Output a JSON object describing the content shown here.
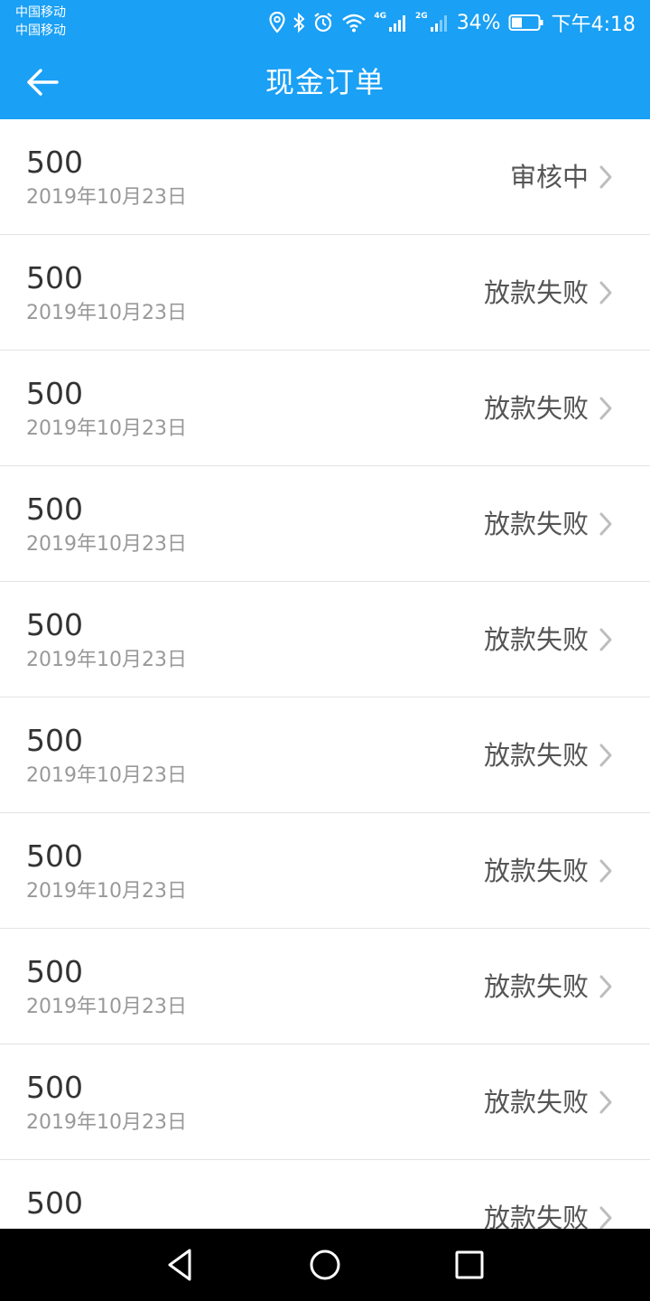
{
  "status_bar": {
    "carrier_1": "中国移动",
    "carrier_2": "中国移动",
    "network_1": "4G",
    "network_2": "2G",
    "battery": "34%",
    "time": "下午4:18"
  },
  "app_bar": {
    "title": "现金订单",
    "back_icon": "arrow-left-icon",
    "color": "#1aa0f5"
  },
  "orders": [
    {
      "amount": "500",
      "date": "2019年10月23日",
      "status": "审核中"
    },
    {
      "amount": "500",
      "date": "2019年10月23日",
      "status": "放款失败"
    },
    {
      "amount": "500",
      "date": "2019年10月23日",
      "status": "放款失败"
    },
    {
      "amount": "500",
      "date": "2019年10月23日",
      "status": "放款失败"
    },
    {
      "amount": "500",
      "date": "2019年10月23日",
      "status": "放款失败"
    },
    {
      "amount": "500",
      "date": "2019年10月23日",
      "status": "放款失败"
    },
    {
      "amount": "500",
      "date": "2019年10月23日",
      "status": "放款失败"
    },
    {
      "amount": "500",
      "date": "2019年10月23日",
      "status": "放款失败"
    },
    {
      "amount": "500",
      "date": "2019年10月23日",
      "status": "放款失败"
    },
    {
      "amount": "500",
      "date": "",
      "status": "放款失败"
    }
  ],
  "nav_bar": {
    "icons": [
      "triangle-back-icon",
      "circle-home-icon",
      "square-recents-icon"
    ]
  }
}
